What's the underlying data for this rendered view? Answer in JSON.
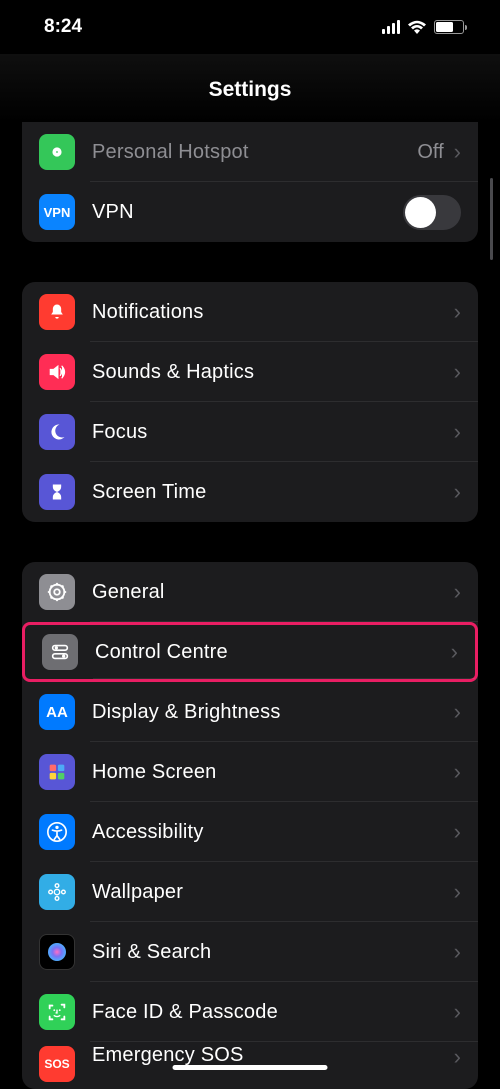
{
  "status": {
    "time": "8:24"
  },
  "header": {
    "title": "Settings"
  },
  "group1": {
    "hotspot": {
      "label": "Personal Hotspot",
      "detail": "Off"
    },
    "vpn": {
      "label": "VPN",
      "badge": "VPN"
    }
  },
  "group2": {
    "notifications": {
      "label": "Notifications"
    },
    "sounds": {
      "label": "Sounds & Haptics"
    },
    "focus": {
      "label": "Focus"
    },
    "screentime": {
      "label": "Screen Time"
    }
  },
  "group3": {
    "general": {
      "label": "General"
    },
    "controlcentre": {
      "label": "Control Centre"
    },
    "display": {
      "label": "Display & Brightness",
      "badge": "AA"
    },
    "homescreen": {
      "label": "Home Screen"
    },
    "accessibility": {
      "label": "Accessibility"
    },
    "wallpaper": {
      "label": "Wallpaper"
    },
    "siri": {
      "label": "Siri & Search"
    },
    "faceid": {
      "label": "Face ID & Passcode"
    },
    "sos": {
      "label": "Emergency SOS",
      "badge": "SOS"
    }
  }
}
